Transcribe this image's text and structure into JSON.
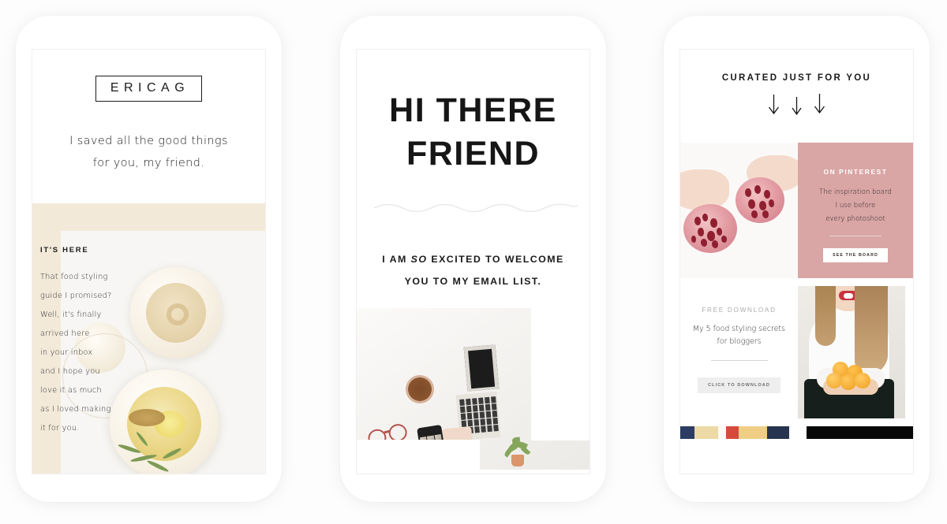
{
  "background_color": "#fdfdfd",
  "phones": [
    {
      "name": "email-welcome-header",
      "logo": "ERICAG",
      "tagline_line1": "I saved all the good things",
      "tagline_line2": "for you, my friend.",
      "band_color": "#f3e9d9",
      "kicker": "IT'S HERE",
      "body_lines": [
        "That food styling",
        "guide I promised?",
        "Well, it's finally",
        "arrived here",
        "in your inbox",
        "and I hope you",
        "love it as much",
        "as I loved making",
        "it for you."
      ],
      "photo_alt": "hummus-bowls-photo"
    },
    {
      "name": "email-greeting",
      "heading_line1": "HI THERE",
      "heading_line2": "FRIEND",
      "divider": "wavy-divider",
      "sub_pre": "I AM ",
      "sub_italic": "SO",
      "sub_post": " EXCITED TO WELCOME",
      "sub_line2": "YOU TO MY EMAIL LIST.",
      "photo_alt": "desk-laptop-coffee-photo"
    },
    {
      "name": "email-curated-content",
      "kicker": "CURATED JUST FOR YOU",
      "arrows": [
        "down-arrow",
        "down-arrow",
        "down-arrow"
      ],
      "pinterest_card": {
        "kicker": "ON PINTEREST",
        "body_lines": [
          "The inspiration board",
          "I use before",
          "every photoshoot"
        ],
        "button_label": "SEE THE BOARD",
        "bg_color": "#d9a5a5",
        "photo_alt": "pomegranate-hands-photo"
      },
      "download_card": {
        "kicker": "FREE DOWNLOAD",
        "body_lines": [
          "My 5 food styling secrets",
          "for bloggers"
        ],
        "button_label": "CLICK TO DOWNLOAD",
        "photo_alt": "woman-holding-oranges-photo"
      },
      "footer_strip": {
        "left_photo_alt": "food-flatlay-strip",
        "right_block_color": "#080808"
      }
    }
  ]
}
